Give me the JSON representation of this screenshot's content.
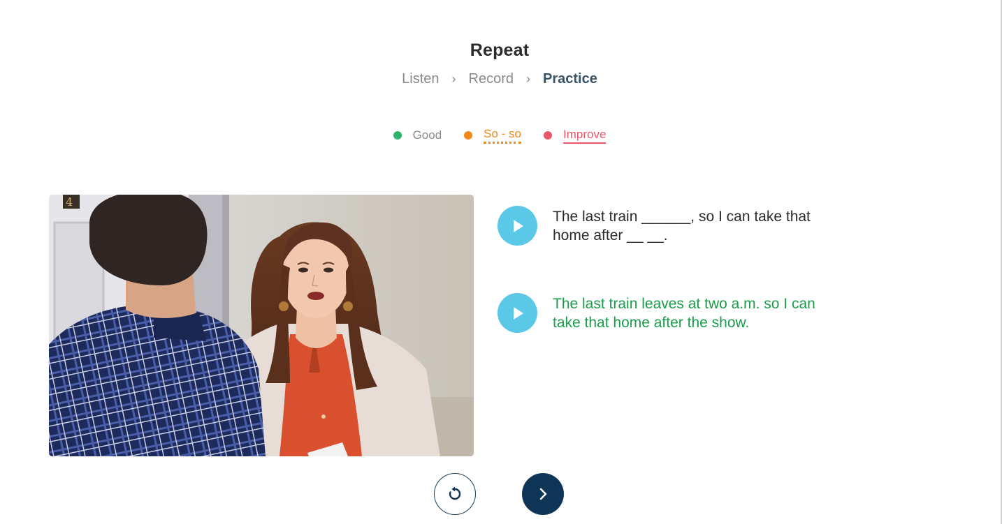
{
  "header": {
    "title": "Repeat",
    "steps": [
      {
        "label": "Listen",
        "active": false
      },
      {
        "label": "Record",
        "active": false
      },
      {
        "label": "Practice",
        "active": true
      }
    ],
    "separator": "›"
  },
  "legend": {
    "good": {
      "label": "Good",
      "color": "#2db46a"
    },
    "soso": {
      "label": "So - so",
      "color": "#f0891a"
    },
    "improve": {
      "label": "Improve",
      "color": "#e85a6a"
    }
  },
  "sentences": {
    "prompt": "The last train ______, so I can take that home after __ __.",
    "answer": "The last train leaves at two a.m. so I can take that home after the show."
  },
  "icons": {
    "play": "play-icon",
    "replay": "replay-icon",
    "next": "chevron-right-icon",
    "video_overlay": "4"
  },
  "colors": {
    "accent_play": "#5bc8e8",
    "navy": "#0f3556",
    "answer_green": "#1a9c4a"
  }
}
